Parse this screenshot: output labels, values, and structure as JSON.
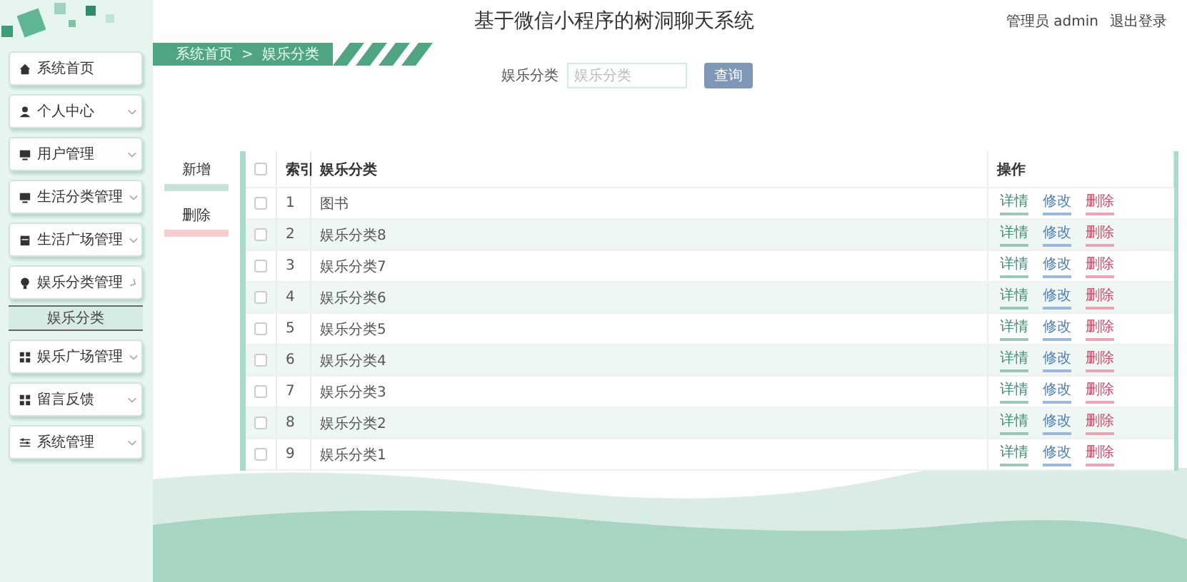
{
  "header": {
    "title": "基于微信小程序的树洞聊天系统",
    "user": "管理员 admin",
    "logout": "退出登录"
  },
  "sidebar": {
    "items": [
      {
        "label": "系统首页"
      },
      {
        "label": "个人中心",
        "expanded": false
      },
      {
        "label": "用户管理",
        "expanded": false
      },
      {
        "label": "生活分类管理",
        "expanded": false
      },
      {
        "label": "生活广场管理",
        "expanded": false
      },
      {
        "label": "娱乐分类管理",
        "expanded": true,
        "children": [
          {
            "label": "娱乐分类",
            "selected": true
          }
        ]
      },
      {
        "label": "娱乐广场管理",
        "expanded": false
      },
      {
        "label": "留言反馈",
        "expanded": false
      },
      {
        "label": "系统管理",
        "expanded": false
      }
    ]
  },
  "breadcrumb": [
    "系统首页",
    "娱乐分类"
  ],
  "breadcrumb_separator": ">",
  "search": {
    "label": "娱乐分类",
    "placeholder": "娱乐分类",
    "button": "查询"
  },
  "actions": [
    "新增",
    "删除"
  ],
  "table": {
    "columns": [
      "索引",
      "娱乐分类",
      "操作"
    ],
    "all_checked": false,
    "rows": [
      {
        "checked": false,
        "index": "1",
        "name": "图书",
        "actions": [
          "详情",
          "修改",
          "删除"
        ]
      },
      {
        "checked": false,
        "index": "2",
        "name": "娱乐分类8",
        "actions": [
          "详情",
          "修改",
          "删除"
        ]
      },
      {
        "checked": false,
        "index": "3",
        "name": "娱乐分类7",
        "actions": [
          "详情",
          "修改",
          "删除"
        ]
      },
      {
        "checked": false,
        "index": "4",
        "name": "娱乐分类6",
        "actions": [
          "详情",
          "修改",
          "删除"
        ]
      },
      {
        "checked": false,
        "index": "5",
        "name": "娱乐分类5",
        "actions": [
          "详情",
          "修改",
          "删除"
        ]
      },
      {
        "checked": false,
        "index": "6",
        "name": "娱乐分类4",
        "actions": [
          "详情",
          "修改",
          "删除"
        ]
      },
      {
        "checked": false,
        "index": "7",
        "name": "娱乐分类3",
        "actions": [
          "详情",
          "修改",
          "删除"
        ]
      },
      {
        "checked": false,
        "index": "8",
        "name": "娱乐分类2",
        "actions": [
          "详情",
          "修改",
          "删除"
        ]
      },
      {
        "checked": false,
        "index": "9",
        "name": "娱乐分类1",
        "actions": [
          "详情",
          "修改",
          "删除"
        ]
      }
    ]
  }
}
